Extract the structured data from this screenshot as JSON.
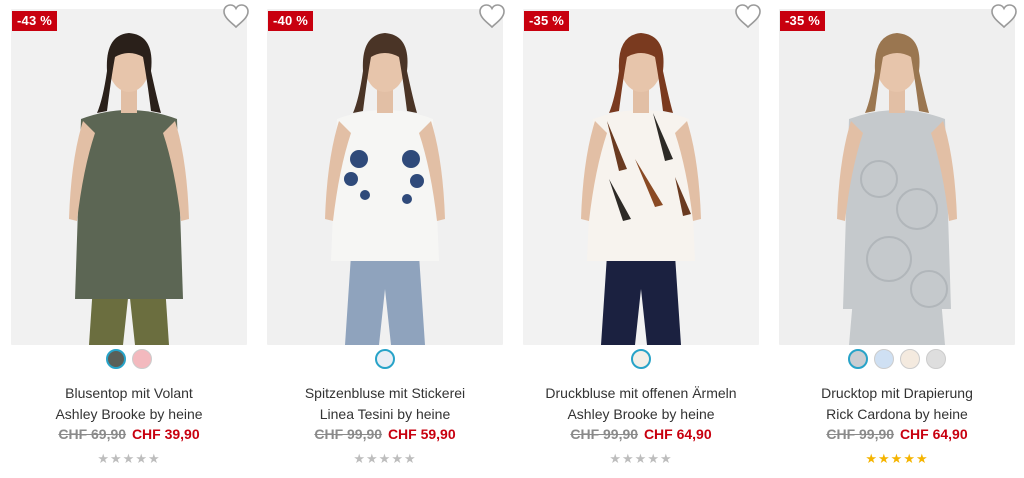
{
  "products": [
    {
      "discount": "-43 %",
      "name": "Blusentop mit Volant",
      "brand": "Ashley Brooke by heine",
      "old_price": "CHF 69,90",
      "new_price": "CHF 39,90",
      "swatch_colors": [
        "#5a5f58",
        "#f3b9be"
      ],
      "rating_filled": 0,
      "colors": {
        "bg": "#f1f1f1",
        "garment": "#5c6654",
        "pants": "#6b6e3f",
        "hair": "#2a201a"
      }
    },
    {
      "discount": "-40 %",
      "name": "Spitzenbluse mit Stickerei",
      "brand": "Linea Tesini by heine",
      "old_price": "CHF 99,90",
      "new_price": "CHF 59,90",
      "swatch_colors": [
        "#e9eef5"
      ],
      "rating_filled": 0,
      "colors": {
        "bg": "#f0f0f0",
        "garment": "#f6f6f4",
        "pants": "#8fa3bd",
        "hair": "#4a3426"
      }
    },
    {
      "discount": "-35 %",
      "name": "Druckbluse mit offenen Ärmeln",
      "brand": "Ashley Brooke by heine",
      "old_price": "CHF 99,90",
      "new_price": "CHF 64,90",
      "swatch_colors": [
        "#f3efe8"
      ],
      "rating_filled": 0,
      "colors": {
        "bg": "#f2f2f2",
        "garment": "#f7f3ee",
        "pants": "#1b2140",
        "hair": "#7a3a1f"
      }
    },
    {
      "discount": "-35 %",
      "name": "Drucktop mit Drapierung",
      "brand": "Rick Cardona by heine",
      "old_price": "CHF 99,90",
      "new_price": "CHF 64,90",
      "swatch_colors": [
        "#c9cdd2",
        "#cfe0f3",
        "#f4eadf",
        "#dedede"
      ],
      "rating_filled": 5,
      "colors": {
        "bg": "#efefef",
        "garment": "#c5c9cc",
        "pants": "#c5c9cc",
        "hair": "#9a7650"
      }
    }
  ],
  "icons": {
    "wishlist": "heart-outline-icon",
    "rating": "star-icon"
  },
  "accent": "#c8000f",
  "rating_color": "#f5b400"
}
